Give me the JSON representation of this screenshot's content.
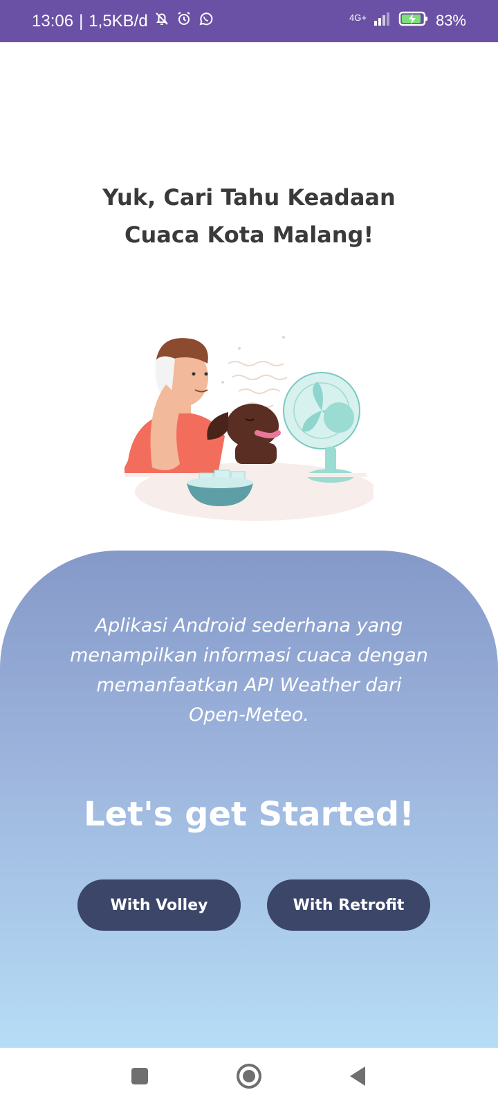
{
  "status_bar": {
    "time": "13:06",
    "separator": "|",
    "net_speed": "1,5KB/d",
    "network": "4G+",
    "battery": "83%",
    "background_color": "#6A51A5",
    "icons": [
      "bell-off-icon",
      "alarm-icon",
      "whatsapp-icon",
      "signal-icon",
      "battery-charging-icon"
    ]
  },
  "main": {
    "title_line1": "Yuk, Cari Tahu Keadaan",
    "title_line2": "Cuaca Kota Malang!",
    "description_lines": [
      "Aplikasi Android sederhana yang",
      "menampilkan informasi cuaca dengan",
      "memanfaatkan API Weather dari",
      "Open-Meteo."
    ],
    "cta": "Let's get Started!",
    "buttons": {
      "volley_label": "With Volley",
      "retrofit_label": "With Retrofit"
    }
  },
  "colors": {
    "button": "#3B4669",
    "panel_top": "#8599C8",
    "panel_bottom": "#B6DDF6"
  },
  "nav_bar": {
    "icons": [
      "recents-icon",
      "home-icon",
      "back-icon"
    ]
  }
}
